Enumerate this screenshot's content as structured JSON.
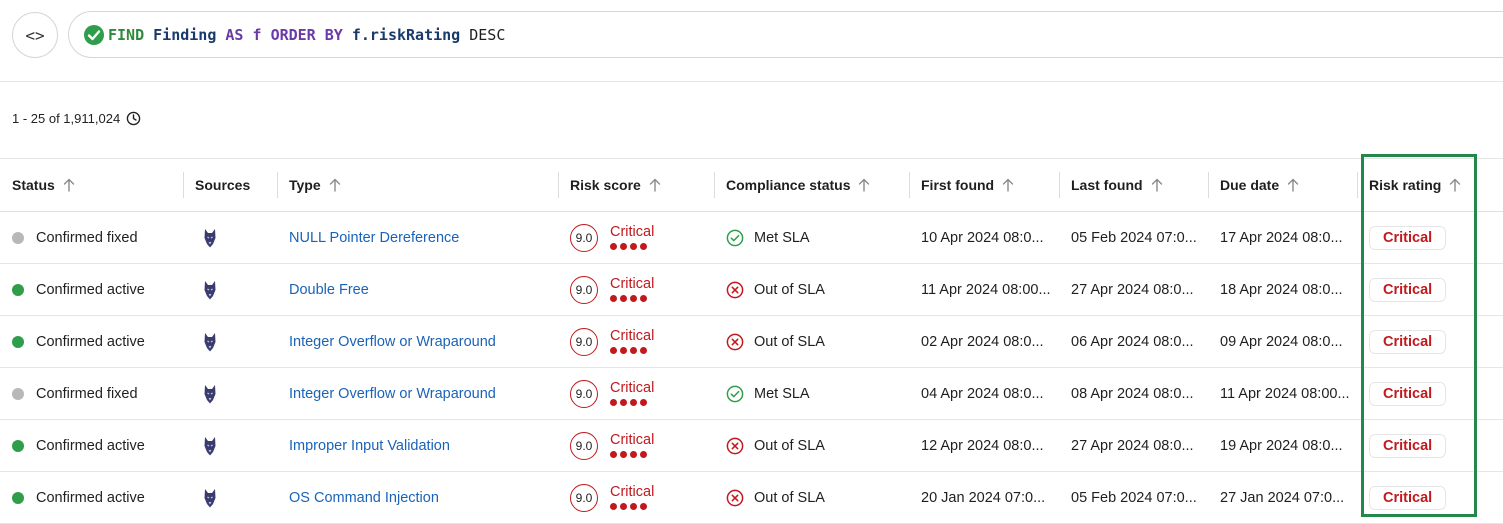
{
  "query": {
    "tokens": [
      {
        "text": "FIND",
        "kind": "kw1"
      },
      {
        "text": "Finding",
        "kind": "ent"
      },
      {
        "text": "AS",
        "kind": "kw2"
      },
      {
        "text": "f",
        "kind": "kw2"
      },
      {
        "text": "ORDER",
        "kind": "kw2"
      },
      {
        "text": "BY",
        "kind": "kw2"
      },
      {
        "text": "f.riskRating",
        "kind": "ent"
      },
      {
        "text": "DESC",
        "kind": "plain"
      }
    ],
    "status_icon": "check-circle-icon",
    "toggle_icon": "code-brackets-icon",
    "toggle_label": "<>"
  },
  "results": {
    "count_text": "1 - 25 of 1,911,024",
    "count_icon": "clock-icon"
  },
  "table": {
    "columns": [
      {
        "key": "status",
        "label": "Status",
        "sortable": true
      },
      {
        "key": "sources",
        "label": "Sources",
        "sortable": false
      },
      {
        "key": "type",
        "label": "Type",
        "sortable": true
      },
      {
        "key": "risk_score",
        "label": "Risk score",
        "sortable": true
      },
      {
        "key": "compliance",
        "label": "Compliance status",
        "sortable": true
      },
      {
        "key": "first_found",
        "label": "First found",
        "sortable": true
      },
      {
        "key": "last_found",
        "label": "Last found",
        "sortable": true
      },
      {
        "key": "due_date",
        "label": "Due date",
        "sortable": true
      },
      {
        "key": "risk_rating",
        "label": "Risk rating",
        "sortable": true
      }
    ],
    "rows": [
      {
        "status": "Confirmed fixed",
        "status_kind": "fixed",
        "type": "NULL Pointer Dereference",
        "score": "9.0",
        "score_label": "Critical",
        "compliance": "Met SLA",
        "compliance_kind": "met",
        "first_found": "10 Apr 2024 08:0...",
        "last_found": "05 Feb 2024 07:0...",
        "due_date": "17 Apr 2024 08:0...",
        "risk_rating": "Critical"
      },
      {
        "status": "Confirmed active",
        "status_kind": "active",
        "type": "Double Free",
        "score": "9.0",
        "score_label": "Critical",
        "compliance": "Out of SLA",
        "compliance_kind": "out",
        "first_found": "11 Apr 2024 08:00...",
        "last_found": "27 Apr 2024 08:0...",
        "due_date": "18 Apr 2024 08:0...",
        "risk_rating": "Critical"
      },
      {
        "status": "Confirmed active",
        "status_kind": "active",
        "type": "Integer Overflow or Wraparound",
        "score": "9.0",
        "score_label": "Critical",
        "compliance": "Out of SLA",
        "compliance_kind": "out",
        "first_found": "02 Apr 2024 08:0...",
        "last_found": "06 Apr 2024 08:0...",
        "due_date": "09 Apr 2024 08:0...",
        "risk_rating": "Critical"
      },
      {
        "status": "Confirmed fixed",
        "status_kind": "fixed",
        "type": "Integer Overflow or Wraparound",
        "score": "9.0",
        "score_label": "Critical",
        "compliance": "Met SLA",
        "compliance_kind": "met",
        "first_found": "04 Apr 2024 08:0...",
        "last_found": "08 Apr 2024 08:0...",
        "due_date": "11 Apr 2024 08:00...",
        "risk_rating": "Critical"
      },
      {
        "status": "Confirmed active",
        "status_kind": "active",
        "type": "Improper Input Validation",
        "score": "9.0",
        "score_label": "Critical",
        "compliance": "Out of SLA",
        "compliance_kind": "out",
        "first_found": "12 Apr 2024 08:0...",
        "last_found": "27 Apr 2024 08:0...",
        "due_date": "19 Apr 2024 08:0...",
        "risk_rating": "Critical"
      },
      {
        "status": "Confirmed active",
        "status_kind": "active",
        "type": "OS Command Injection",
        "score": "9.0",
        "score_label": "Critical",
        "compliance": "Out of SLA",
        "compliance_kind": "out",
        "first_found": "20 Jan 2024 07:0...",
        "last_found": "05 Feb 2024 07:0...",
        "due_date": "27 Jan 2024 07:0...",
        "risk_rating": "Critical"
      }
    ],
    "source_icon": "wolf-head-icon",
    "colors": {
      "active": "#2e9e4a",
      "fixed": "#b8b8b8",
      "critical": "#c2191d",
      "met": "#2e9e4a",
      "out": "#c2191d",
      "link": "#1a63b8",
      "highlight": "#23894a"
    }
  }
}
